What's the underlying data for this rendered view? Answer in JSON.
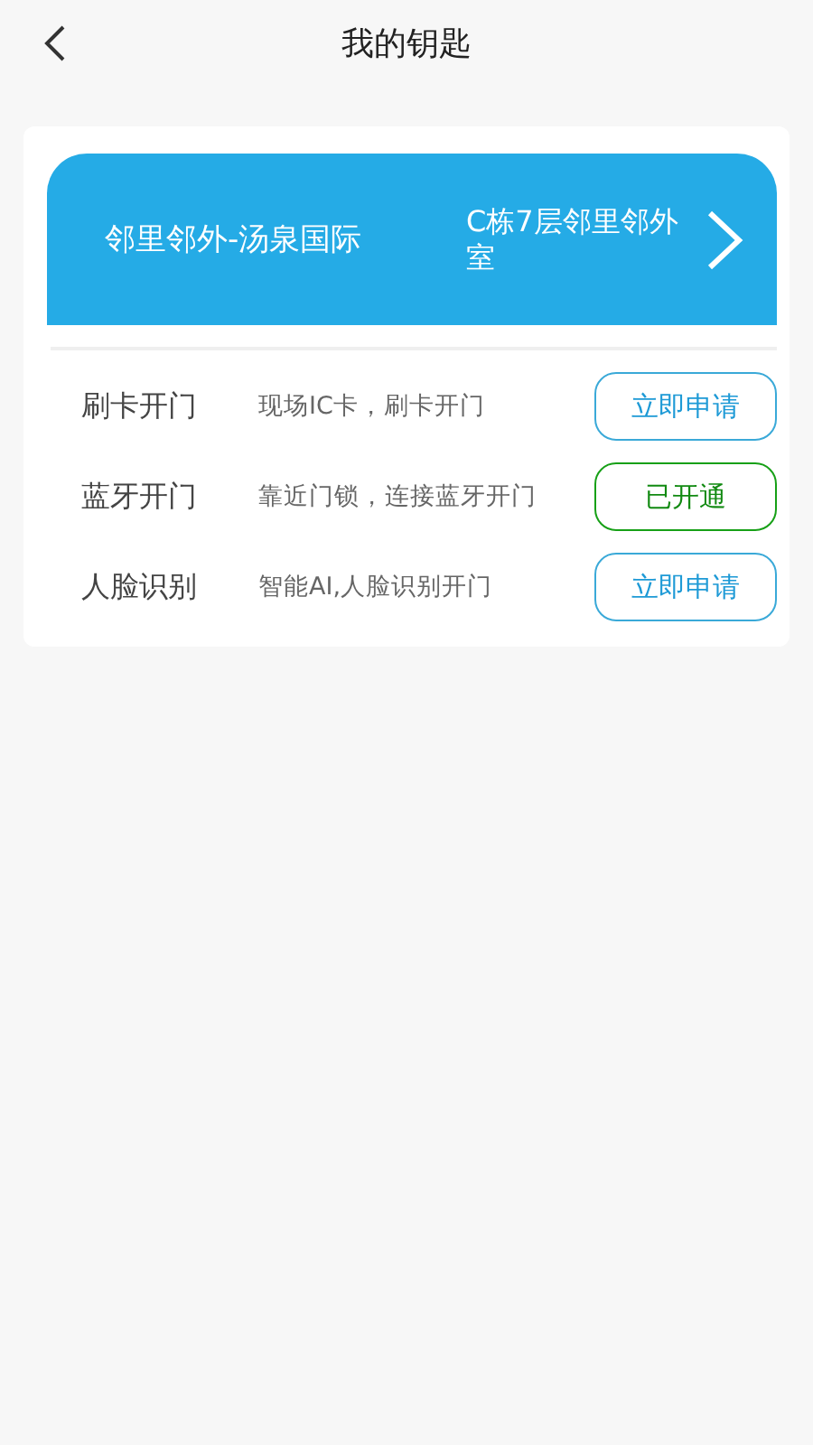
{
  "header": {
    "title": "我的钥匙"
  },
  "key_card": {
    "community": "邻里邻外-汤泉国际",
    "room": "C栋7层邻里邻外室"
  },
  "methods": [
    {
      "name": "刷卡开门",
      "description": "现场IC卡，刷卡开门",
      "action": "立即申请",
      "activated": false
    },
    {
      "name": "蓝牙开门",
      "description": "靠近门锁，连接蓝牙开门",
      "action": "已开通",
      "activated": true
    },
    {
      "name": "人脸识别",
      "description": "智能AI,人脸识别开门",
      "action": "立即申请",
      "activated": false
    }
  ]
}
